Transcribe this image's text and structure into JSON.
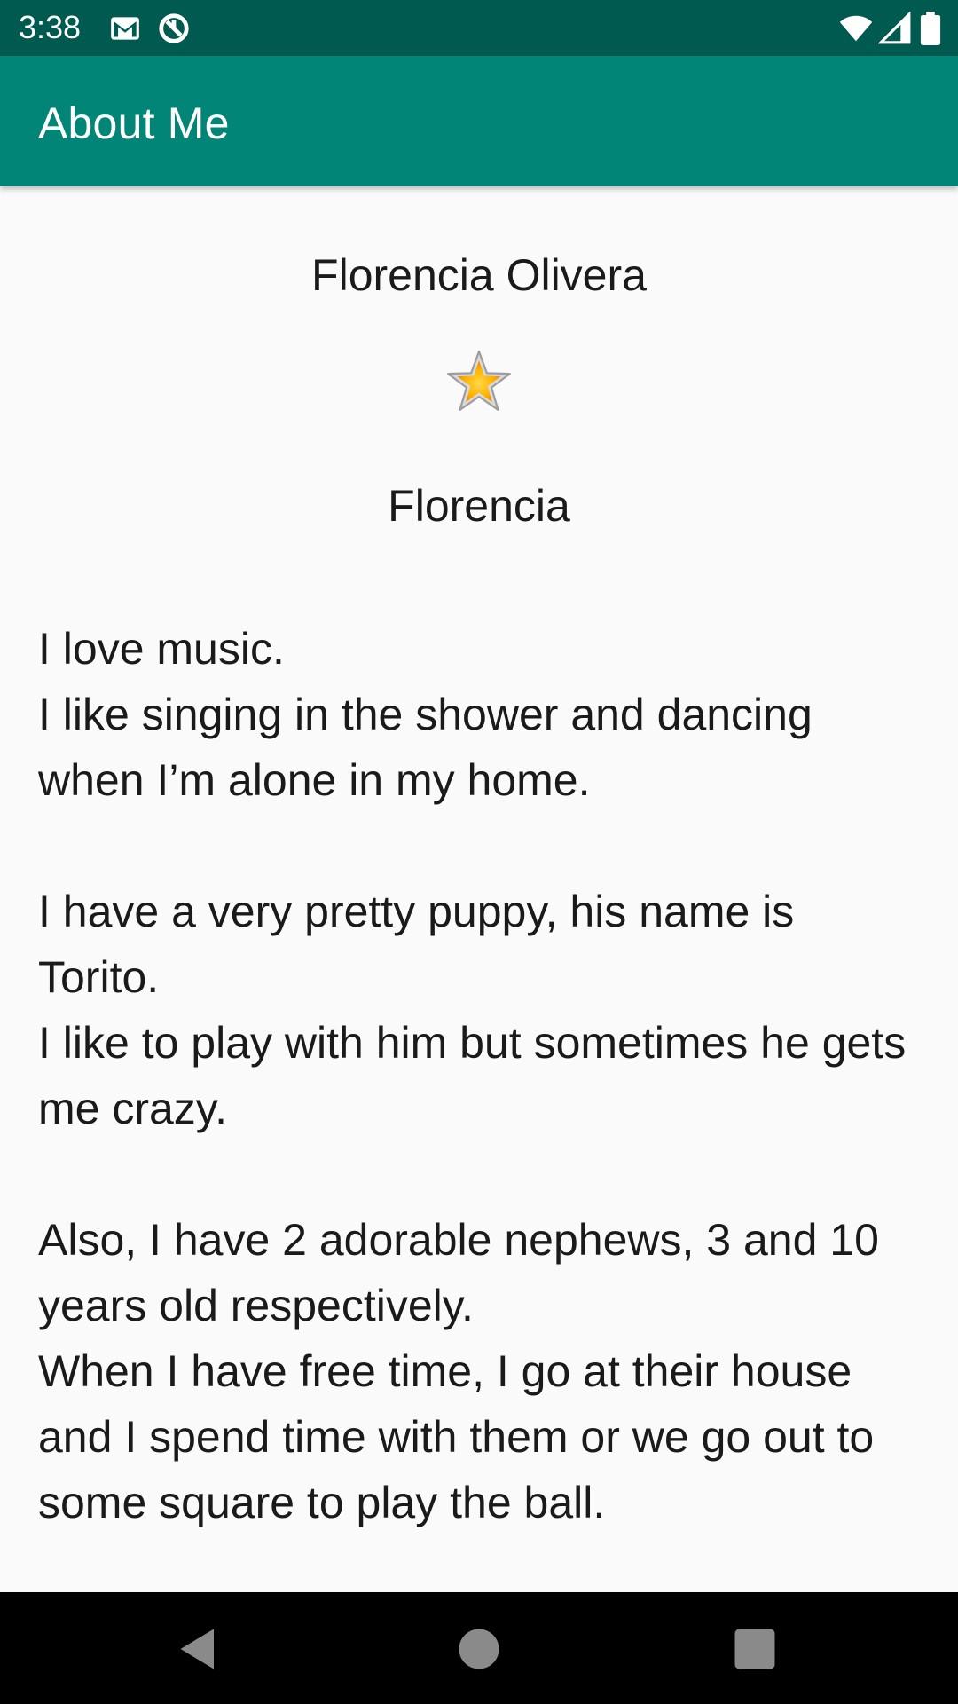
{
  "status_bar": {
    "time": "3:38",
    "icons_left": [
      "gmail-icon",
      "sync-icon"
    ],
    "icons_right": [
      "wifi-icon",
      "signal-icon",
      "battery-icon"
    ]
  },
  "app_bar": {
    "title": "About Me"
  },
  "profile": {
    "name": "Florencia Olivera",
    "star_icon": "star-icon",
    "nickname": "Florencia"
  },
  "bio": {
    "paragraphs": [
      "I love music.\nI like singing in the shower and dancing when I’m alone in my home.",
      "I have a very pretty puppy, his name is Torito.\nI like to play with him but sometimes he gets me crazy.",
      "Also, I have 2 adorable nephews, 3 and 10 years old respectively.\nWhen I have free time, I go at their house and I spend time with them or we go out to some square to play the ball."
    ]
  },
  "nav_bar": {
    "buttons": [
      "back-icon",
      "home-icon",
      "recents-icon"
    ]
  },
  "colors": {
    "status_bar": "#005a4f",
    "app_bar": "#008577",
    "background": "#fafafa",
    "text": "#1a1a1a",
    "star": "#ffb300"
  }
}
